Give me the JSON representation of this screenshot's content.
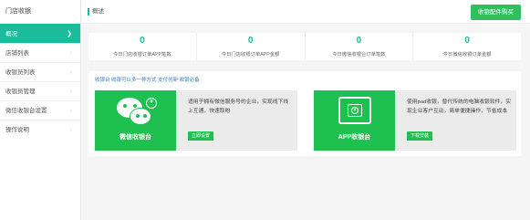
{
  "sidebar": {
    "title": "门店收银",
    "items": [
      {
        "label": "概况",
        "active": true
      },
      {
        "label": "店铺列表"
      },
      {
        "label": "收银员列表"
      },
      {
        "label": "收银员管理"
      },
      {
        "label": "微信收银台设置"
      },
      {
        "label": "操作说明"
      }
    ]
  },
  "header": {
    "title": "概述",
    "buy_button": "收银配件购买"
  },
  "stats": [
    {
      "value": "0",
      "label": "今日门店收银订单APP笔数"
    },
    {
      "value": "0",
      "label": "今日门店收银订单APP金额"
    },
    {
      "value": "0",
      "label": "今日微信收银台订单笔数"
    },
    {
      "value": "0",
      "label": "今日微信收银订单金额"
    }
  ],
  "note": "收银台 收银可以多一种方式 支付创新 收银必备",
  "cards": [
    {
      "name": "微信收银台",
      "icon": "wechat-icon",
      "desc": "适用于拥有微信服务号的企业，实现线下线上互通，快速取粉",
      "action": "立即设置"
    },
    {
      "name": "APP收银台",
      "icon": "pad-cashier-icon",
      "desc": "使用pad收银，替代传统的电脑收银软件，实现企业客户互动，简单便捷操作，节省成本",
      "action": "下载安装"
    }
  ],
  "colors": {
    "accent": "#1bbc9b",
    "card_green": "#1ec14f",
    "button_green": "#2fbf5e"
  }
}
